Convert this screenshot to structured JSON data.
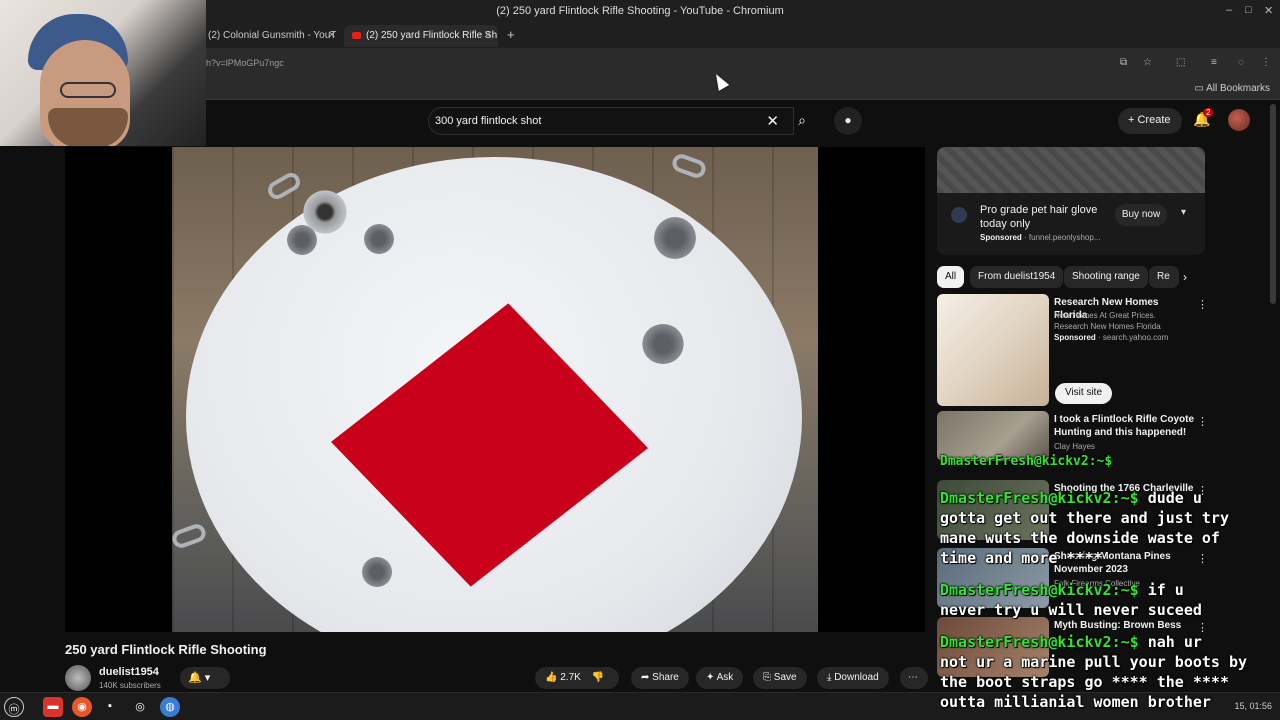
{
  "window": {
    "title": "(2) 250 yard Flintlock Rifle Shooting - YouTube - Chromium",
    "minimize": "–",
    "maximize": "□",
    "close": "✕"
  },
  "tabs": [
    {
      "label": "(2) Colonial Gunsmith - YouT",
      "active": false
    },
    {
      "label": "(2) 250 yard Flintlock Rifle Sh",
      "active": true
    }
  ],
  "tab_close": "✕",
  "new_tab": "+",
  "address": {
    "url": "h?v=lPMoGPu7ngc"
  },
  "bookmarks": {
    "all_bookmarks": "All Bookmarks"
  },
  "search": {
    "query": "300 yard flintlock shot",
    "clear_icon": "✕",
    "search_icon": "⌕",
    "mic_icon": "🎤"
  },
  "header": {
    "create_label": "Create",
    "notifications_count": "2"
  },
  "video": {
    "title": "250 yard Flintlock Rifle Shooting",
    "channel": "duelist1954",
    "subscribers": "140K subscribers"
  },
  "actions": {
    "likes": "2.7K",
    "share": "Share",
    "ask": "Ask",
    "save": "Save",
    "download": "Download",
    "more": "⋯"
  },
  "ad": {
    "title": "Pro grade pet hair glove today only",
    "sponsored": "Sponsored",
    "domain": "funnel.peonlyshop...",
    "cta": "Buy now"
  },
  "chips": [
    "All",
    "From duelist1954",
    "Shooting range",
    "Re"
  ],
  "recommendations": [
    {
      "title": "Research New Homes Florida",
      "line1": "New Homes At Great Prices.",
      "line2": "Research New Homes Florida",
      "sponsored": "Sponsored",
      "domain": "search.yahoo.com",
      "cta": "Visit site"
    },
    {
      "title": "I took a Flintlock Rifle Coyote Hunting and this happened!",
      "channel": "Clay Hayes"
    },
    {
      "title": "Shooting the 1766 Charleville"
    },
    {
      "title": "Shooting Montana Pines November 2023",
      "channel": "Folk Firearms Collective"
    },
    {
      "title": "Myth Busting: Brown Bess"
    }
  ],
  "chat_overlay": [
    {
      "user": "DmasterFresh@kickv2:~$",
      "msg": " dude u"
    },
    {
      "user": "",
      "msg": "gotta get out there and just try"
    },
    {
      "user": "",
      "msg": "mane wuts the downside waste of"
    },
    {
      "user": "",
      "msg": "time and more ****"
    },
    {
      "user": "DmasterFresh@kickv2:~$",
      "msg": " if u"
    },
    {
      "user": "",
      "msg": "never try u will never suceed"
    },
    {
      "user": "DmasterFresh@kickv2:~$",
      "msg": " nah ur"
    },
    {
      "user": "",
      "msg": "not ur a marine pull your boots by"
    },
    {
      "user": "",
      "msg": "the boot straps go **** the ****"
    },
    {
      "user": "",
      "msg": "outta millianial women brother"
    }
  ],
  "chat_top_fragment": "DmasterFresh@kickv2:~$",
  "taskbar": {
    "clock": "15, 01:56"
  },
  "colors": {
    "accent_red": "#cc0000",
    "terminal_green": "#34e234",
    "target_red": "#c8001a"
  }
}
